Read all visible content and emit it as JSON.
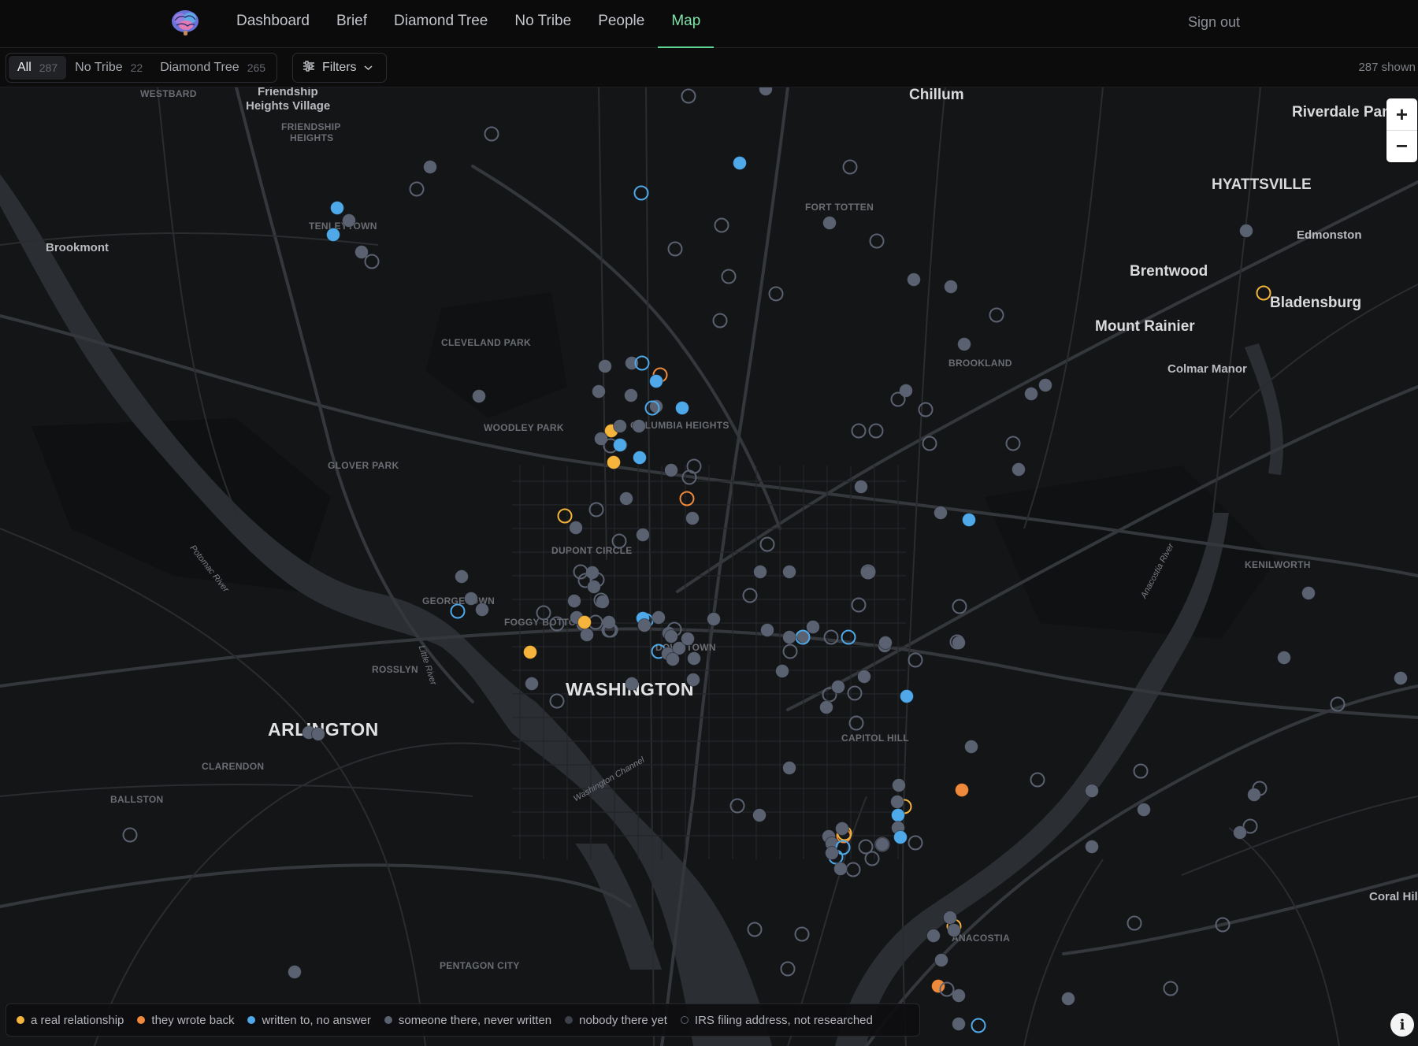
{
  "header": {
    "logo_icon": "brain-icon",
    "nav": [
      {
        "label": "Dashboard",
        "active": false
      },
      {
        "label": "Brief",
        "active": false
      },
      {
        "label": "Diamond Tree",
        "active": false
      },
      {
        "label": "No Tribe",
        "active": false
      },
      {
        "label": "People",
        "active": false
      },
      {
        "label": "Map",
        "active": true
      }
    ],
    "sign_out": "Sign out",
    "accent": "#6ee3a4"
  },
  "filterbar": {
    "segments": [
      {
        "label": "All",
        "count": "287",
        "active": true
      },
      {
        "label": "No Tribe",
        "count": "22",
        "active": false
      },
      {
        "label": "Diamond Tree",
        "count": "265",
        "active": false
      }
    ],
    "filters_label": "Filters",
    "shown": "287 shown"
  },
  "map": {
    "labels": [
      {
        "text": "Chillum",
        "kind": "city"
      },
      {
        "text": "Riverdale Park",
        "kind": "city"
      },
      {
        "text": "HYATTSVILLE",
        "kind": "city"
      },
      {
        "text": "Edmonston",
        "kind": "town"
      },
      {
        "text": "Brentwood",
        "kind": "city"
      },
      {
        "text": "Bladensburg",
        "kind": "city"
      },
      {
        "text": "Mount Rainier",
        "kind": "city"
      },
      {
        "text": "Colmar Manor",
        "kind": "town"
      },
      {
        "text": "Brookmont",
        "kind": "town"
      },
      {
        "text": "Friendship",
        "kind": "town"
      },
      {
        "text": "Heights Village",
        "kind": "town"
      },
      {
        "text": "WESTBARD",
        "kind": "hood"
      },
      {
        "text": "FRIENDSHIP",
        "kind": "hood"
      },
      {
        "text": "HEIGHTS",
        "kind": "hood"
      },
      {
        "text": "TENLEYTOWN",
        "kind": "hood"
      },
      {
        "text": "FORT TOTTEN",
        "kind": "hood"
      },
      {
        "text": "BROOKLAND",
        "kind": "hood"
      },
      {
        "text": "CLEVELAND PARK",
        "kind": "hood"
      },
      {
        "text": "WOODLEY PARK",
        "kind": "hood"
      },
      {
        "text": "COLUMBIA HEIGHTS",
        "kind": "hood"
      },
      {
        "text": "GLOVER PARK",
        "kind": "hood"
      },
      {
        "text": "DUPONT CIRCLE",
        "kind": "hood"
      },
      {
        "text": "GEORGETOWN",
        "kind": "hood"
      },
      {
        "text": "FOGGY BOTTOM",
        "kind": "hood"
      },
      {
        "text": "DOWNTOWN",
        "kind": "hood"
      },
      {
        "text": "ROSSLYN",
        "kind": "hood"
      },
      {
        "text": "WASHINGTON",
        "kind": "big"
      },
      {
        "text": "ARLINGTON",
        "kind": "big"
      },
      {
        "text": "CLARENDON",
        "kind": "hood"
      },
      {
        "text": "BALLSTON",
        "kind": "hood"
      },
      {
        "text": "CAPITOL HILL",
        "kind": "hood"
      },
      {
        "text": "KENILWORTH",
        "kind": "hood"
      },
      {
        "text": "ANACOSTIA",
        "kind": "hood"
      },
      {
        "text": "PENTAGON CITY",
        "kind": "hood"
      },
      {
        "text": "Coral Hills",
        "kind": "town"
      },
      {
        "text": "Potomac River",
        "kind": "water"
      },
      {
        "text": "Anacostia River",
        "kind": "water"
      },
      {
        "text": "Washington Channel",
        "kind": "water"
      },
      {
        "text": "Little River",
        "kind": "water"
      }
    ]
  },
  "zoom": {
    "in_label": "+",
    "out_label": "−"
  },
  "legend": [
    {
      "label": "a real relationship",
      "color": "#f5b43c",
      "style": "filled"
    },
    {
      "label": "they wrote back",
      "color": "#ef8a3c",
      "style": "filled"
    },
    {
      "label": "written to, no answer",
      "color": "#4fa8e8",
      "style": "filled"
    },
    {
      "label": "someone there, never written",
      "color": "#5a6170",
      "style": "filled"
    },
    {
      "label": "nobody there yet",
      "color": "#3c414b",
      "style": "filled"
    },
    {
      "label": "IRS filing address, not researched",
      "color": "#5a6170",
      "style": "ring"
    }
  ],
  "info_icon": "info-icon"
}
